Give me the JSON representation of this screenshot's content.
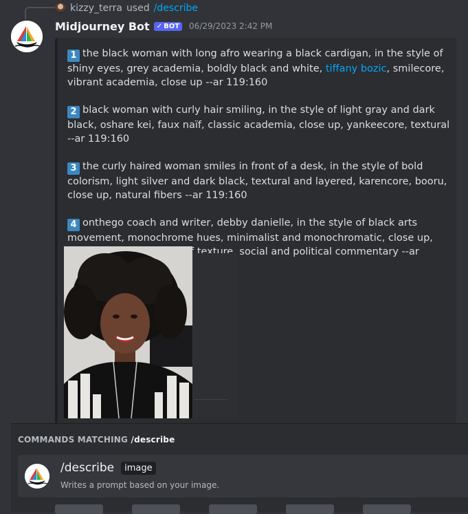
{
  "reply": {
    "username": "kizzy_terra",
    "used_text": "used",
    "command": "/describe"
  },
  "message": {
    "bot_name": "Midjourney Bot",
    "badge": "BOT",
    "timestamp": "06/29/2023 2:42 PM"
  },
  "descriptions": [
    {
      "number": "1",
      "text_before": "the black woman with long afro wearing a black cardigan, in the style of shiny eyes, grey academia, boldly black and white, ",
      "link": "tiffany bozic",
      "text_after": ", smilecore, vibrant academia, close up --ar 119:160"
    },
    {
      "number": "2",
      "text": "black woman with curly hair smiling, in the style of light gray and dark black, oshare kei, faux naïf, classic academia, close up, yankeecore, textural --ar 119:160"
    },
    {
      "number": "3",
      "text": "the curly haired woman smiles in front of a desk, in the style of bold colorism, light silver and dark black, textural and layered, karencore, booru, close up, natural fibers --ar 119:160"
    },
    {
      "number": "4",
      "text": "onthego coach and writer, debby danielle, in the style of black arts movement, monochrome hues, minimalist and monochromatic, close up, shiny eyes, playful use of texture, social and political commentary --ar 119:160"
    }
  ],
  "autocomplete": {
    "title_prefix": "COMMANDS MATCHING",
    "title_query": "/describe",
    "command": "/describe",
    "param": "image",
    "description": "Writes a prompt based on your image."
  },
  "colors": {
    "background": "#313338",
    "embed": "#2b2d31",
    "link": "#00a8fc",
    "badge": "#5865f2",
    "number_tile": "#3b88c3"
  }
}
